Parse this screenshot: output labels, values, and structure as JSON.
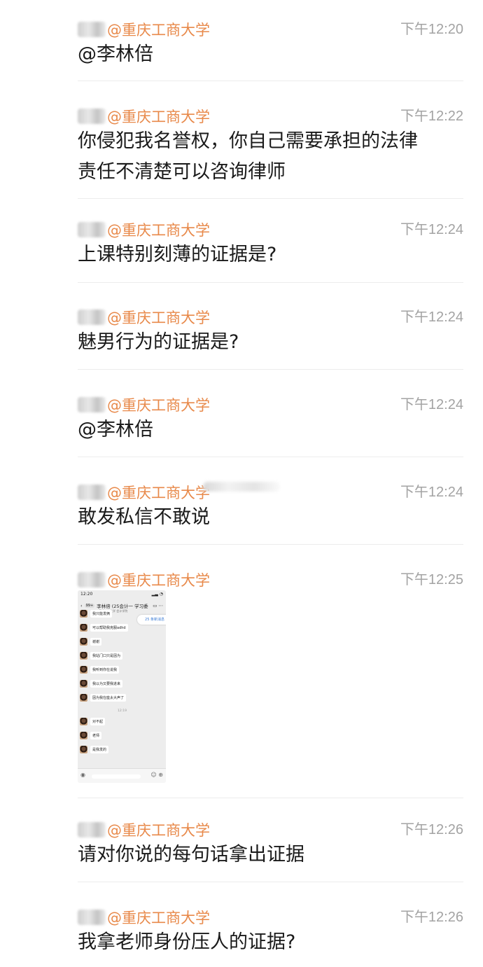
{
  "messages": [
    {
      "sender": "@重庆工商大学",
      "time": "下午12:20",
      "lines": [
        "@李林倍"
      ]
    },
    {
      "sender": "@重庆工商大学",
      "time": "下午12:22",
      "lines": [
        "你侵犯我名誉权，你自己需要承担的法律",
        "责任不清楚可以咨询律师"
      ]
    },
    {
      "sender": "@重庆工商大学",
      "time": "下午12:24",
      "lines": [
        "上课特别刻薄的证据是?"
      ]
    },
    {
      "sender": "@重庆工商大学",
      "time": "下午12:24",
      "lines": [
        "魅男行为的证据是?"
      ]
    },
    {
      "sender": "@重庆工商大学",
      "time": "下午12:24",
      "lines": [
        "@李林倍"
      ]
    },
    {
      "sender": "@重庆工商大学",
      "time": "下午12:24",
      "lines": [
        "敢发私信不敢说"
      ]
    },
    {
      "sender": "@重庆工商大学",
      "time": "下午12:25",
      "lines": []
    },
    {
      "sender": "@重庆工商大学",
      "time": "下午12:26",
      "lines": [
        "请对你说的每句话拿出证据"
      ]
    },
    {
      "sender": "@重庆工商大学",
      "time": "下午12:26",
      "lines": [
        "我拿老师身份压人的证据?"
      ]
    }
  ],
  "screenshot": {
    "status_time": "12:20",
    "title": "李林倍 (25会计一 学习委",
    "subtitle": "重庆工商大学 会计学院",
    "pill": "25 条新消息",
    "rows": [
      "我只能发俩",
      "可以帮助我克服adhd",
      "谢谢",
      "我站门口只是因为",
      "我听到你在说我",
      "我以为又要我进来",
      "因为我在座太大声了",
      "对不起",
      "老师",
      "是我发的"
    ],
    "time_mid": "12:19"
  }
}
